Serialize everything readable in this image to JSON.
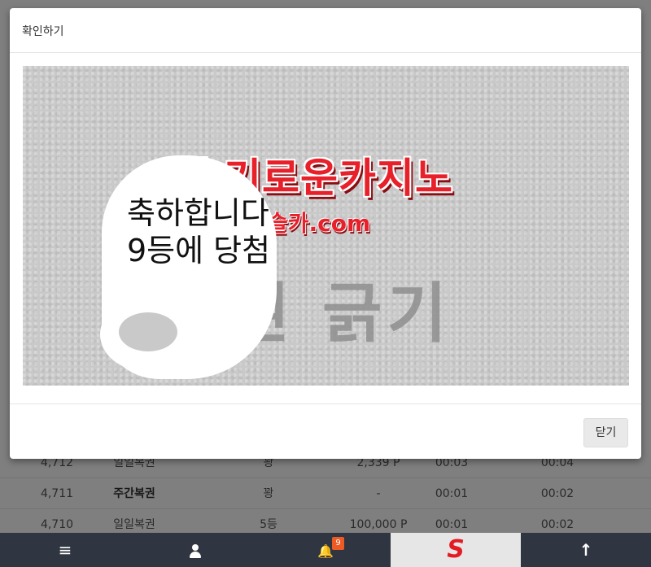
{
  "modal": {
    "title": "확인하기",
    "close_label": "닫기"
  },
  "ticket": {
    "brand": "슬기로운카지노",
    "domain": "슬카.com",
    "scratch_text": "복권 긁기",
    "win_line1": "축하합니다",
    "win_line2": "9등에 당첨",
    "big_number": "9"
  },
  "table": {
    "rows": [
      {
        "id": "4,712",
        "name": "일일복권",
        "rank": "꽝",
        "prize": "2,339 P",
        "time1": "00:03",
        "time2": "00:04"
      },
      {
        "id": "4,711",
        "name": "주간복권",
        "rank": "꽝",
        "prize": "-",
        "time1": "00:01",
        "time2": "00:02"
      },
      {
        "id": "4,710",
        "name": "일일복권",
        "rank": "5등",
        "prize": "100,000 P",
        "time1": "00:01",
        "time2": "00:02"
      }
    ]
  },
  "nav": {
    "menu_icon": "≡",
    "bell_icon": "🔔",
    "up_icon": "↑",
    "notification_count": "9",
    "logo_letter": "S"
  }
}
